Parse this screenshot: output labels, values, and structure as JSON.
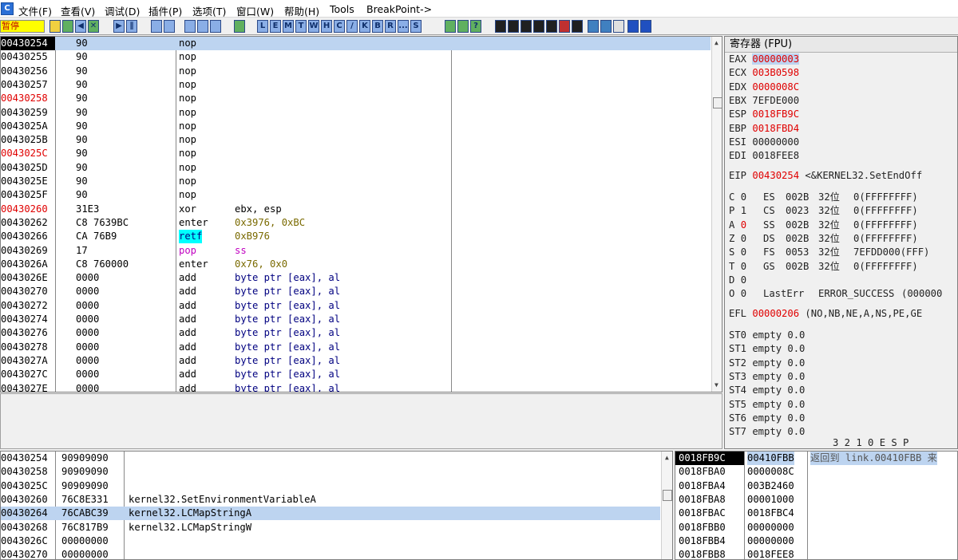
{
  "menu": {
    "app_icon": "C",
    "items": [
      "文件(F)",
      "查看(V)",
      "调试(D)",
      "插件(P)",
      "选项(T)",
      "窗口(W)",
      "帮助(H)",
      "Tools",
      "BreakPoint->"
    ]
  },
  "toolbar": {
    "status": "暂停",
    "letter_buttons": [
      "L",
      "E",
      "M",
      "T",
      "W",
      "H",
      "C",
      "/",
      "K",
      "B",
      "R",
      "...",
      "S"
    ]
  },
  "disasm": {
    "rows": [
      {
        "addr": "00430254",
        "hex": "90",
        "mn": "nop",
        "op": "",
        "addr_style": "current",
        "sel": true
      },
      {
        "addr": "00430255",
        "hex": "90",
        "mn": "nop",
        "op": ""
      },
      {
        "addr": "00430256",
        "hex": "90",
        "mn": "nop",
        "op": ""
      },
      {
        "addr": "00430257",
        "hex": "90",
        "mn": "nop",
        "op": ""
      },
      {
        "addr": "00430258",
        "hex": "90",
        "mn": "nop",
        "op": "",
        "addr_style": "red"
      },
      {
        "addr": "00430259",
        "hex": "90",
        "mn": "nop",
        "op": ""
      },
      {
        "addr": "0043025A",
        "hex": "90",
        "mn": "nop",
        "op": ""
      },
      {
        "addr": "0043025B",
        "hex": "90",
        "mn": "nop",
        "op": ""
      },
      {
        "addr": "0043025C",
        "hex": "90",
        "mn": "nop",
        "op": "",
        "addr_style": "red"
      },
      {
        "addr": "0043025D",
        "hex": "90",
        "mn": "nop",
        "op": ""
      },
      {
        "addr": "0043025E",
        "hex": "90",
        "mn": "nop",
        "op": ""
      },
      {
        "addr": "0043025F",
        "hex": "90",
        "mn": "nop",
        "op": ""
      },
      {
        "addr": "00430260",
        "hex": "31E3",
        "mn": "xor",
        "op": "ebx, esp",
        "addr_style": "red"
      },
      {
        "addr": "00430262",
        "hex": "C8 7639BC",
        "mn": "enter",
        "op": "0x3976, 0xBC",
        "op_style": "olive"
      },
      {
        "addr": "00430266",
        "hex": "CA 76B9",
        "mn": "retf",
        "op": "0xB976",
        "mn_style": "retf",
        "op_style": "olive"
      },
      {
        "addr": "00430269",
        "hex": "17",
        "mn": "pop",
        "op": "ss",
        "mn_style": "magenta",
        "op_style": "magenta"
      },
      {
        "addr": "0043026A",
        "hex": "C8 760000",
        "mn": "enter",
        "op": "0x76, 0x0",
        "op_style": "olive"
      },
      {
        "addr": "0043026E",
        "hex": "0000",
        "mn": "add",
        "op": "byte ptr [eax], al",
        "op_style": "blue"
      },
      {
        "addr": "00430270",
        "hex": "0000",
        "mn": "add",
        "op": "byte ptr [eax], al",
        "op_style": "blue"
      },
      {
        "addr": "00430272",
        "hex": "0000",
        "mn": "add",
        "op": "byte ptr [eax], al",
        "op_style": "blue"
      },
      {
        "addr": "00430274",
        "hex": "0000",
        "mn": "add",
        "op": "byte ptr [eax], al",
        "op_style": "blue"
      },
      {
        "addr": "00430276",
        "hex": "0000",
        "mn": "add",
        "op": "byte ptr [eax], al",
        "op_style": "blue"
      },
      {
        "addr": "00430278",
        "hex": "0000",
        "mn": "add",
        "op": "byte ptr [eax], al",
        "op_style": "blue"
      },
      {
        "addr": "0043027A",
        "hex": "0000",
        "mn": "add",
        "op": "byte ptr [eax], al",
        "op_style": "blue"
      },
      {
        "addr": "0043027C",
        "hex": "0000",
        "mn": "add",
        "op": "byte ptr [eax], al",
        "op_style": "blue"
      },
      {
        "addr": "0043027E",
        "hex": "0000",
        "mn": "add",
        "op": "byte ptr [eax], al",
        "op_style": "blue"
      }
    ]
  },
  "registers": {
    "title": "寄存器 (FPU)",
    "gp": [
      {
        "name": "EAX",
        "value": "00000003",
        "style": "cur"
      },
      {
        "name": "ECX",
        "value": "003B0598",
        "style": "red"
      },
      {
        "name": "EDX",
        "value": "0000008C",
        "style": "red"
      },
      {
        "name": "EBX",
        "value": "7EFDE000",
        "style": ""
      },
      {
        "name": "ESP",
        "value": "0018FB9C",
        "style": "red"
      },
      {
        "name": "EBP",
        "value": "0018FBD4",
        "style": "red"
      },
      {
        "name": "ESI",
        "value": "00000000",
        "style": ""
      },
      {
        "name": "EDI",
        "value": "0018FEE8",
        "style": ""
      }
    ],
    "eip": {
      "name": "EIP",
      "value": "00430254",
      "comment": "<&KERNEL32.SetEndOff"
    },
    "flags": [
      {
        "flag": "C",
        "bit": "0",
        "seg": "ES",
        "sel": "002B",
        "bits": "32位",
        "base": "0(FFFFFFFF)"
      },
      {
        "flag": "P",
        "bit": "1",
        "seg": "CS",
        "sel": "0023",
        "bits": "32位",
        "base": "0(FFFFFFFF)"
      },
      {
        "flag": "A",
        "bit": "0",
        "seg": "SS",
        "sel": "002B",
        "bits": "32位",
        "base": "0(FFFFFFFF)",
        "red_bit": true
      },
      {
        "flag": "Z",
        "bit": "0",
        "seg": "DS",
        "sel": "002B",
        "bits": "32位",
        "base": "0(FFFFFFFF)"
      },
      {
        "flag": "S",
        "bit": "0",
        "seg": "FS",
        "sel": "0053",
        "bits": "32位",
        "base": "7EFDD000(FFF)"
      },
      {
        "flag": "T",
        "bit": "0",
        "seg": "GS",
        "sel": "002B",
        "bits": "32位",
        "base": "0(FFFFFFFF)"
      },
      {
        "flag": "D",
        "bit": "0",
        "seg": "",
        "sel": "",
        "bits": "",
        "base": ""
      },
      {
        "flag": "O",
        "bit": "0",
        "seg": "LastErr",
        "sel": "ERROR_SUCCESS",
        "bits": "(000000",
        "base": ""
      }
    ],
    "efl": {
      "name": "EFL",
      "value": "00000206",
      "comment": "(NO,NB,NE,A,NS,PE,GE"
    },
    "fpu": [
      "ST0 empty 0.0",
      "ST1 empty 0.0",
      "ST2 empty 0.0",
      "ST3 empty 0.0",
      "ST4 empty 0.0",
      "ST5 empty 0.0",
      "ST6 empty 0.0",
      "ST7 empty 0.0"
    ],
    "fpu_header": "3 2 1 0      E S P"
  },
  "dump": {
    "rows": [
      {
        "addr": "00430254",
        "hex": "90909090",
        "comment": ""
      },
      {
        "addr": "00430258",
        "hex": "90909090",
        "comment": ""
      },
      {
        "addr": "0043025C",
        "hex": "90909090",
        "comment": ""
      },
      {
        "addr": "00430260",
        "hex": "76C8E331",
        "comment": "kernel32.SetEnvironmentVariableA"
      },
      {
        "addr": "00430264",
        "hex": "76CABC39",
        "comment": "kernel32.LCMapStringA",
        "sel": true
      },
      {
        "addr": "00430268",
        "hex": "76C817B9",
        "comment": "kernel32.LCMapStringW"
      },
      {
        "addr": "0043026C",
        "hex": "00000000",
        "comment": ""
      },
      {
        "addr": "00430270",
        "hex": "00000000",
        "comment": ""
      }
    ]
  },
  "stack": {
    "rows": [
      {
        "addr": "0018FB9C",
        "value": "00410FBB",
        "comment": "返回到 link.00410FBB 来",
        "cur": true
      },
      {
        "addr": "0018FBA0",
        "value": "0000008C",
        "comment": ""
      },
      {
        "addr": "0018FBA4",
        "value": "003B2460",
        "comment": ""
      },
      {
        "addr": "0018FBA8",
        "value": "00001000",
        "comment": ""
      },
      {
        "addr": "0018FBAC",
        "value": "0018FBC4",
        "comment": ""
      },
      {
        "addr": "0018FBB0",
        "value": "00000000",
        "comment": ""
      },
      {
        "addr": "0018FBB4",
        "value": "00000000",
        "comment": ""
      },
      {
        "addr": "0018FBB8",
        "value": "0018FEE8",
        "comment": ""
      }
    ]
  }
}
